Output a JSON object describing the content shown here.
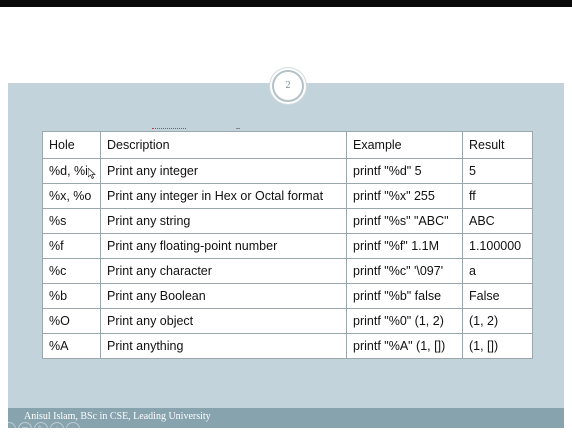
{
  "slide": {
    "page_number": "2",
    "footer": "Anisul Islam, BSc in CSE, Leading University"
  },
  "table": {
    "headers": [
      "Hole",
      "Description",
      "Example",
      "Result"
    ],
    "rows": [
      [
        "%d, %i",
        "Print any integer",
        "printf \"%d\" 5",
        "5"
      ],
      [
        "%x, %o",
        "Print any integer in Hex or Octal format",
        "printf \"%x\" 255",
        "ff"
      ],
      [
        "%s",
        "Print any string",
        "printf \"%s\" \"ABC\"",
        "ABC"
      ],
      [
        "%f",
        "Print any floating-point number",
        "printf \"%f\" 1.1M",
        "1.100000"
      ],
      [
        "%c",
        "Print any character",
        "printf \"%c\" '\\097'",
        "a"
      ],
      [
        "%b",
        "Print any Boolean",
        "printf \"%b\" false",
        "False"
      ],
      [
        "%O",
        "Print any object",
        "printf \"%0\" (1, 2)",
        "(1, 2)"
      ],
      [
        "%A",
        "Print anything",
        "printf \"%A\" (1, [])",
        "(1, [])"
      ]
    ]
  },
  "colors": {
    "body_band": "#c2d3dc",
    "footer_band": "#86a3ae",
    "table_border": "#9aa8ae"
  },
  "icons": {
    "cursor": "cursor-arrow-icon",
    "nav": [
      "prev-slide-icon",
      "menu-icon",
      "pen-icon",
      "zoom-icon",
      "next-slide-icon"
    ]
  }
}
